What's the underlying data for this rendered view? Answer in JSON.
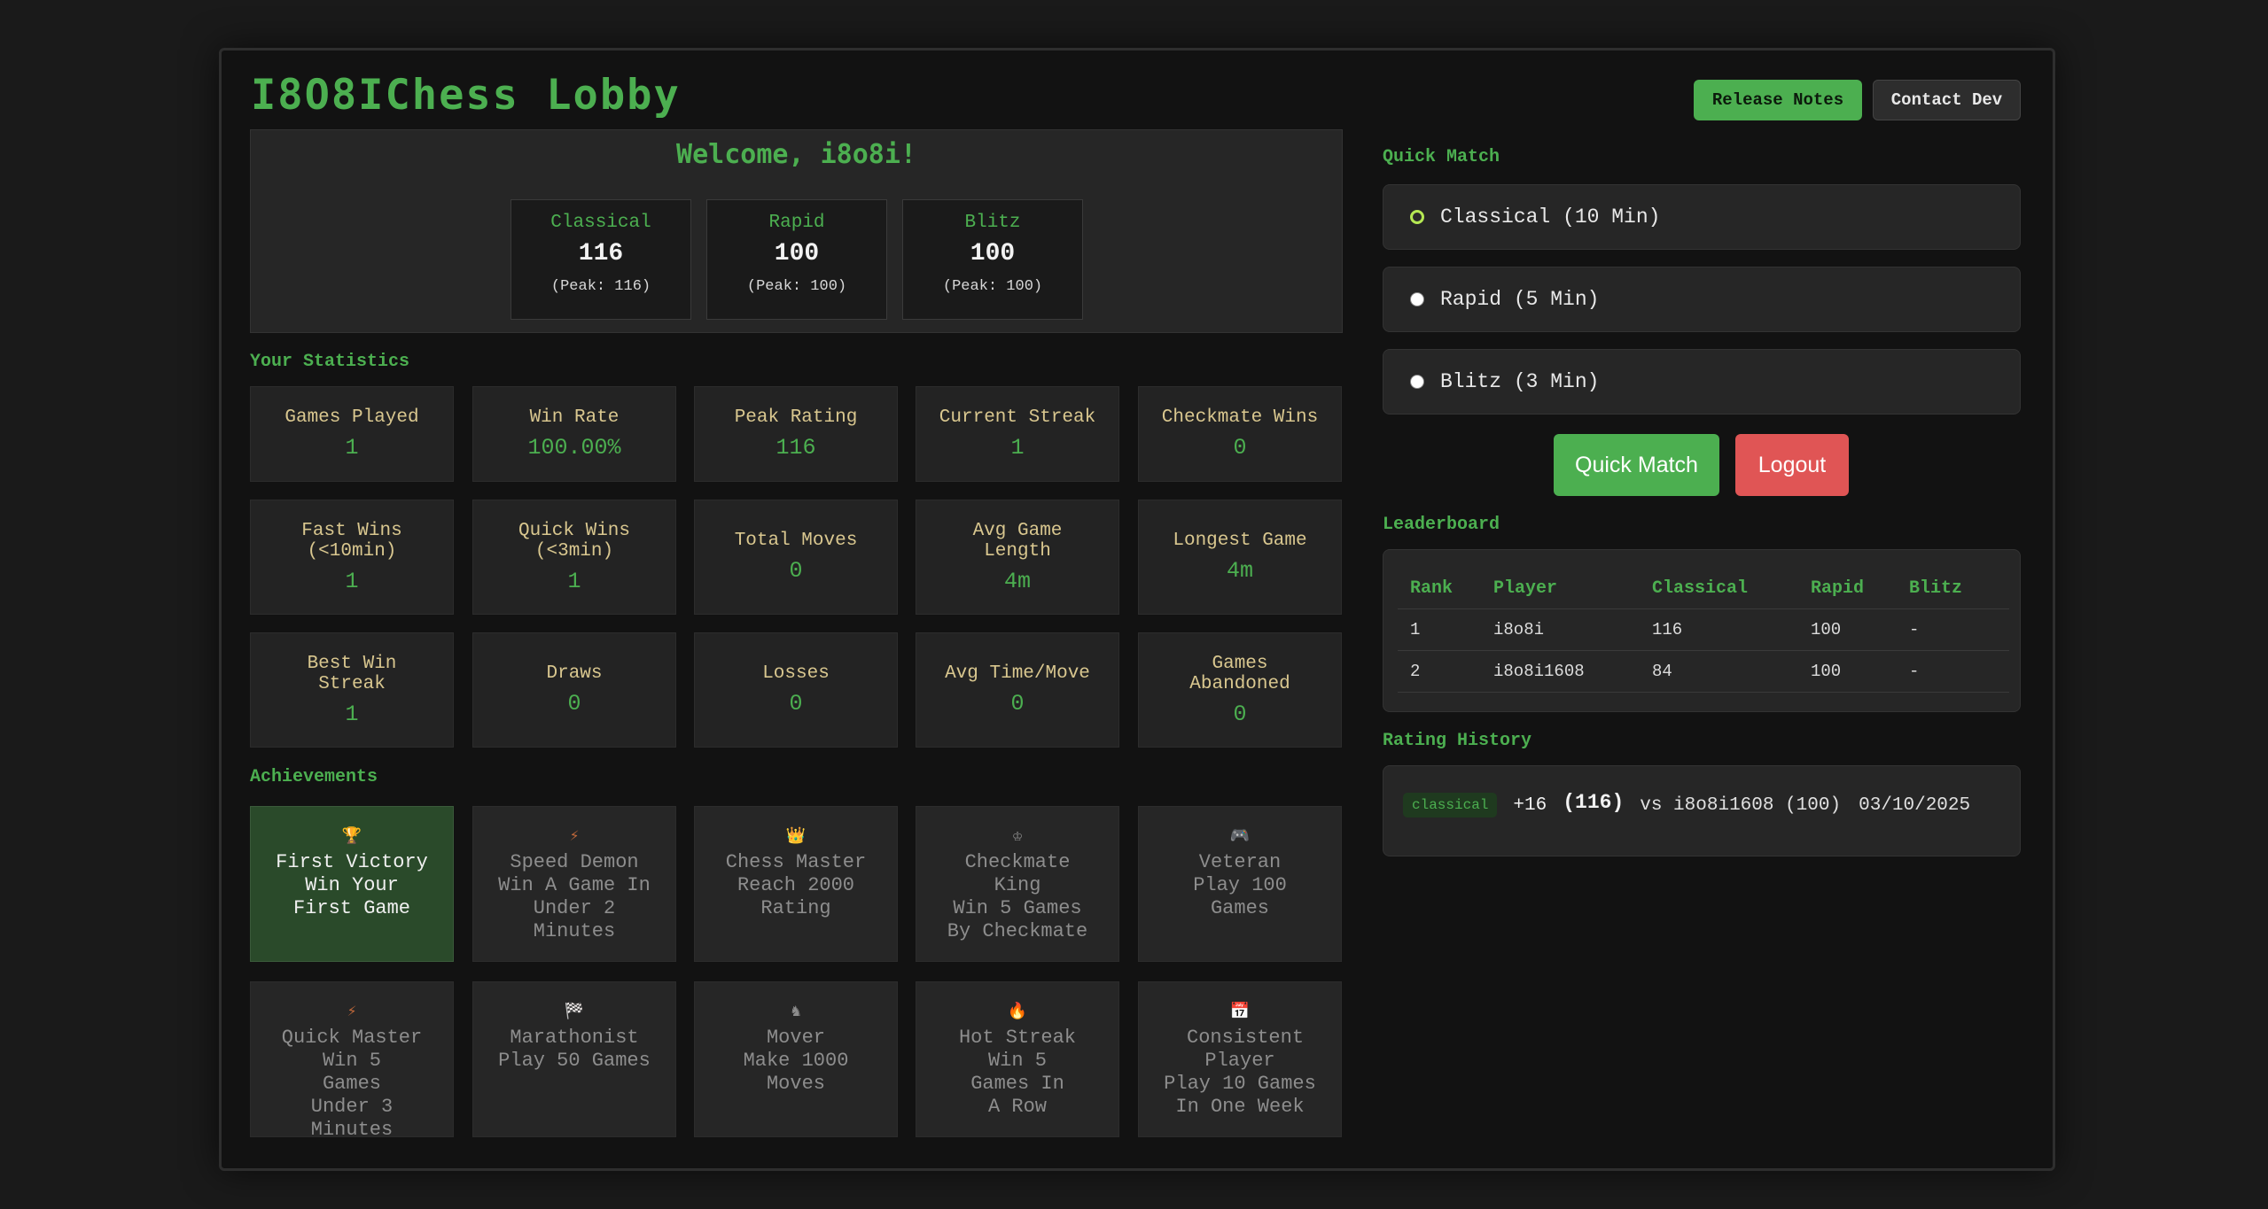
{
  "header": {
    "title": "I8O8IChess Lobby",
    "release_notes": "Release Notes",
    "contact_dev": "Contact Dev"
  },
  "welcome": {
    "text": "Welcome, i8o8i!",
    "ratings": [
      {
        "name": "Classical",
        "value": "116",
        "peak": "(Peak: 116)"
      },
      {
        "name": "Rapid",
        "value": "100",
        "peak": "(Peak: 100)"
      },
      {
        "name": "Blitz",
        "value": "100",
        "peak": "(Peak: 100)"
      }
    ]
  },
  "statistics": {
    "label": "Your Statistics",
    "items": [
      {
        "label": "Games Played",
        "value": "1"
      },
      {
        "label": "Win Rate",
        "value": "100.00%"
      },
      {
        "label": "Peak Rating",
        "value": "116"
      },
      {
        "label": "Current Streak",
        "value": "1"
      },
      {
        "label": "Checkmate Wins",
        "value": "0"
      },
      {
        "label": "Fast Wins (<10min)",
        "value": "1"
      },
      {
        "label": "Quick Wins (<3min)",
        "value": "1"
      },
      {
        "label": "Total Moves",
        "value": "0"
      },
      {
        "label": "Avg Game Length",
        "value": "4m"
      },
      {
        "label": "Longest Game",
        "value": "4m"
      },
      {
        "label": "Best Win Streak",
        "value": "1"
      },
      {
        "label": "Draws",
        "value": "0"
      },
      {
        "label": "Losses",
        "value": "0"
      },
      {
        "label": "Avg Time/Move",
        "value": "0"
      },
      {
        "label": "Games Abandoned",
        "value": "0"
      }
    ]
  },
  "achievements": {
    "label": "Achievements",
    "items": [
      {
        "icon": "trophy-icon",
        "title": "First Victory",
        "desc": "Win Your First Game",
        "unlocked": true
      },
      {
        "icon": "lightning-icon",
        "title": "Speed Demon",
        "desc": "Win A Game In Under 2 Minutes",
        "unlocked": false
      },
      {
        "icon": "crown-icon",
        "title": "Chess Master",
        "desc": "Reach 2000 Rating",
        "unlocked": false
      },
      {
        "icon": "chess-king-icon",
        "title": "Checkmate King",
        "desc": "Win 5 Games By Checkmate",
        "unlocked": false
      },
      {
        "icon": "gamepad-icon",
        "title": "Veteran",
        "desc": "Play 100 Games",
        "unlocked": false
      },
      {
        "icon": "lightning-icon",
        "title": "Quick Master",
        "desc": "Win 5 Games Under 3 Minutes",
        "unlocked": false
      },
      {
        "icon": "checkered-flag-icon",
        "title": "Marathonist",
        "desc": "Play 50 Games",
        "unlocked": false
      },
      {
        "icon": "chess-knight-icon",
        "title": "Mover",
        "desc": "Make 1000 Moves",
        "unlocked": false
      },
      {
        "icon": "fire-icon",
        "title": "Hot Streak",
        "desc": "Win 5 Games In A Row",
        "unlocked": false
      },
      {
        "icon": "calendar-icon",
        "title": "Consistent Player",
        "desc": "Play 10 Games In One Week",
        "unlocked": false
      }
    ]
  },
  "quick_match": {
    "label": "Quick Match",
    "options": [
      {
        "label": "Classical (10 Min)",
        "selected": true
      },
      {
        "label": "Rapid (5 Min)",
        "selected": false
      },
      {
        "label": "Blitz (3 Min)",
        "selected": false
      }
    ],
    "quick_match_button": "Quick Match",
    "logout_button": "Logout"
  },
  "leaderboard": {
    "label": "Leaderboard",
    "columns": [
      "Rank",
      "Player",
      "Classical",
      "Rapid",
      "Blitz"
    ],
    "rows": [
      [
        "1",
        "i8o8i",
        "116",
        "100",
        "-"
      ],
      [
        "2",
        "i8o8i1608",
        "84",
        "100",
        "-"
      ]
    ]
  },
  "rating_history": {
    "label": "Rating History",
    "entries": [
      {
        "mode": "classical",
        "change": "+16",
        "rating": "(116)",
        "opponent": "vs i8o8i1608 (100)",
        "date": "03/10/2025"
      }
    ]
  },
  "colors": {
    "accent": "#4caf50",
    "logout": "#e05555",
    "background": "#1a1a1a",
    "stat_label": "#d9c78f"
  }
}
